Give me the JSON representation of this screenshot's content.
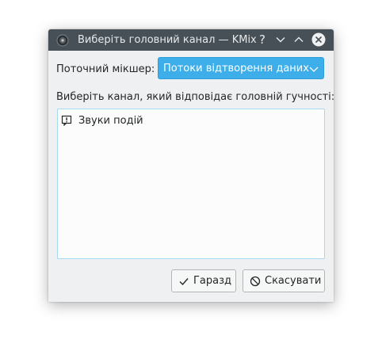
{
  "window": {
    "title": "Виберіть головний канал — KMix",
    "help_symbol": "?"
  },
  "mixer": {
    "label": "Поточний мікшер:",
    "selected": "Потоки відтворення даних"
  },
  "channels": {
    "label": "Виберіть канал, який відповідає головній гучності:",
    "items": [
      {
        "label": "Звуки подій"
      }
    ]
  },
  "buttons": {
    "ok_label": "Гаразд",
    "cancel_label": "Скасувати"
  },
  "colors": {
    "titlebar": "#475057",
    "accent": "#3daee9",
    "window_bg": "#eff0f1"
  }
}
